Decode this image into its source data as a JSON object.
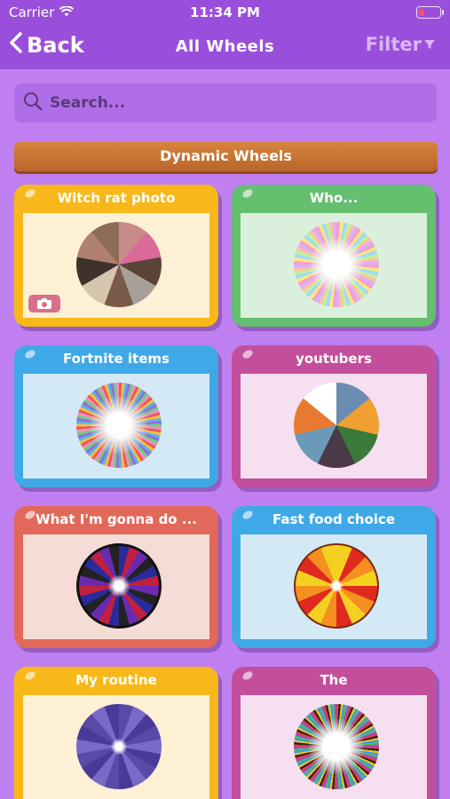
{
  "status": {
    "carrier": "Carrier",
    "time": "11:34 PM"
  },
  "nav": {
    "back": "Back",
    "title": "All Wheels",
    "filter": "Filter"
  },
  "search": {
    "placeholder": "Search..."
  },
  "section": {
    "title": "Dynamic Wheels"
  },
  "cards": [
    {
      "title": "Witch rat photo"
    },
    {
      "title": "Who..."
    },
    {
      "title": "Fortnite items"
    },
    {
      "title": "youtubers"
    },
    {
      "title": "What I'm gonna do ..."
    },
    {
      "title": "Fast food choice"
    },
    {
      "title": "My routine"
    },
    {
      "title": "The"
    }
  ]
}
